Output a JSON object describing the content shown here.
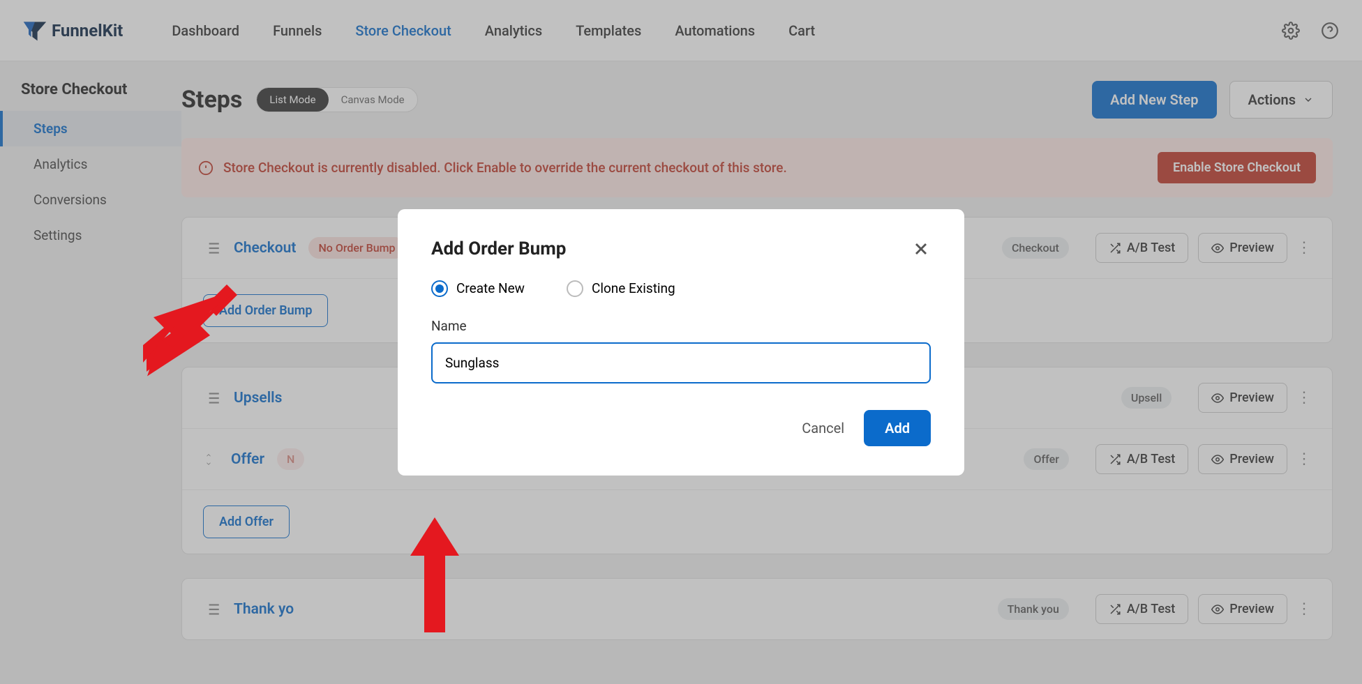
{
  "brand": "FunnelKit",
  "topnav": [
    "Dashboard",
    "Funnels",
    "Store Checkout",
    "Analytics",
    "Templates",
    "Automations",
    "Cart"
  ],
  "topnav_active_index": 2,
  "sidebar": {
    "title": "Store Checkout",
    "items": [
      "Steps",
      "Analytics",
      "Conversions",
      "Settings"
    ],
    "active_index": 0
  },
  "page": {
    "title": "Steps",
    "modes": {
      "list": "List Mode",
      "canvas": "Canvas Mode"
    },
    "add_step": "Add New Step",
    "actions": "Actions"
  },
  "alert": {
    "text": "Store Checkout is currently disabled. Click Enable to override the current checkout of this store.",
    "button": "Enable Store Checkout"
  },
  "steps": [
    {
      "name": "Checkout",
      "badge": "No Order Bump",
      "tag": "Checkout",
      "abtest": "A/B Test",
      "preview": "Preview",
      "sub_button": "Add Order Bump"
    },
    {
      "name": "Upsells",
      "tag": "Upsell",
      "preview": "Preview",
      "offer": {
        "name": "Offer",
        "tag": "Offer",
        "abtest": "A/B Test",
        "preview": "Preview"
      },
      "sub_button": "Add Offer"
    },
    {
      "name": "Thank yo",
      "tag": "Thank you",
      "abtest": "A/B Test",
      "preview": "Preview"
    }
  ],
  "modal": {
    "title": "Add Order Bump",
    "create_new": "Create New",
    "clone_existing": "Clone Existing",
    "name_label": "Name",
    "name_value": "Sunglass ",
    "cancel": "Cancel",
    "add": "Add"
  }
}
